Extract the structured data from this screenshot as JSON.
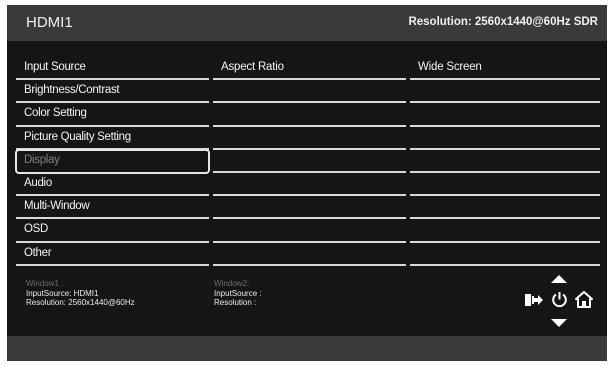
{
  "header": {
    "title": "HDMI1",
    "resolution": "Resolution: 2560x1440@60Hz SDR"
  },
  "menu": {
    "items": [
      {
        "label": "Input Source"
      },
      {
        "label": "Brightness/Contrast"
      },
      {
        "label": "Color Setting"
      },
      {
        "label": "Picture Quality Setting"
      },
      {
        "label": "Display",
        "selected": true
      },
      {
        "label": "Audio"
      },
      {
        "label": "Multi-Window"
      },
      {
        "label": "OSD"
      },
      {
        "label": "Other"
      }
    ]
  },
  "submenu": {
    "column2": [
      "Aspect Ratio",
      "",
      "",
      "",
      "",
      "",
      "",
      "",
      ""
    ],
    "column3": [
      "Wide Screen",
      "",
      "",
      "",
      "",
      "",
      "",
      "",
      ""
    ]
  },
  "window1": {
    "title": "Window1 :",
    "input_source": "InputSource: HDMI1",
    "resolution": "Resolution: 2560x1440@60Hz"
  },
  "window2": {
    "title": "Window2:",
    "input_source": "InputSource :",
    "resolution": "Resolution :"
  },
  "icons": {
    "up": "triangle-up-icon",
    "down": "triangle-down-icon",
    "exit": "exit-icon",
    "power": "power-icon",
    "home": "home-icon"
  },
  "colors": {
    "background": "#151515",
    "header": "#3a3a3a",
    "divider": "#d8d8d8",
    "selected_text": "#808080"
  }
}
